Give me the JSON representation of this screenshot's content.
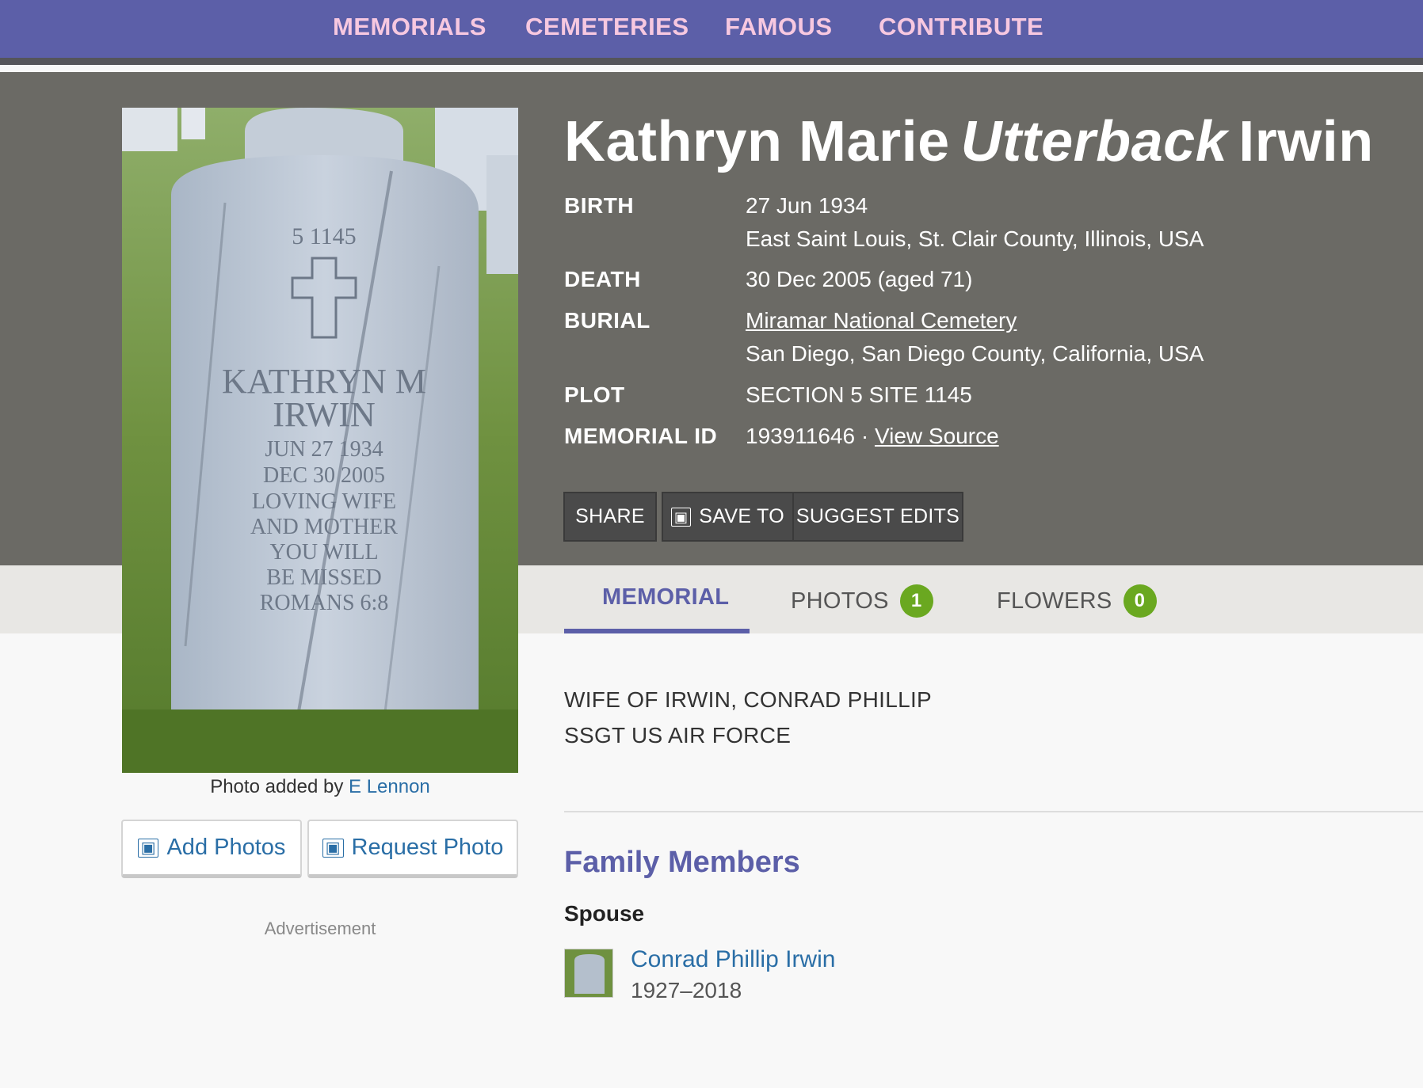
{
  "nav": {
    "items": [
      "MEMORIALS",
      "CEMETERIES",
      "FAMOUS",
      "CONTRIBUTE"
    ]
  },
  "memorial": {
    "first_names": "Kathryn Marie",
    "maiden_name": "Utterback",
    "last_name": "Irwin",
    "facts": {
      "birth_label": "BIRTH",
      "birth_date": "27 Jun 1934",
      "birth_place": "East Saint Louis, St. Clair County, Illinois, USA",
      "death_label": "DEATH",
      "death_date": "30 Dec 2005 (aged 71)",
      "burial_label": "BURIAL",
      "burial_cemetery": "Miramar National Cemetery",
      "burial_place": "San Diego, San Diego County, California, USA",
      "plot_label": "PLOT",
      "plot_value": "SECTION 5 SITE 1145",
      "id_label": "MEMORIAL ID",
      "id_value": "193911646",
      "id_sep": "·",
      "view_source": "View Source"
    }
  },
  "actions": {
    "share": "SHARE",
    "save_to": "SAVE TO",
    "suggest_edits": "SUGGEST EDITS",
    "save_icon": "bookmark-icon"
  },
  "photo": {
    "credit_prefix": "Photo added by",
    "credit_author": "E Lennon",
    "add_photos": "Add Photos",
    "request_photo": "Request Photo",
    "add_icon": "camera-icon",
    "request_icon": "photo-request-icon"
  },
  "headstone": {
    "number": "5   1145",
    "lines": [
      "KATHRYN M",
      "IRWIN",
      "JUN 27 1934",
      "DEC 30 2005",
      "LOVING WIFE",
      "AND MOTHER",
      "YOU WILL",
      "BE MISSED",
      "ROMANS 6:8"
    ]
  },
  "tabs": {
    "memorial": "MEMORIAL",
    "photos": "PHOTOS",
    "photos_count": "1",
    "flowers": "FLOWERS",
    "flowers_count": "0"
  },
  "bio": {
    "line1": "WIFE OF IRWIN, CONRAD PHILLIP",
    "line2": "SSGT US AIR FORCE"
  },
  "family": {
    "title": "Family Members",
    "spouse_label": "Spouse",
    "spouse_name": "Conrad Phillip Irwin",
    "spouse_dates": "1927–2018"
  },
  "advertisement": "Advertisement",
  "colors": {
    "nav_bg": "#5c5fa8",
    "nav_text": "#f7c8e0",
    "hero_bg": "#6b6a65",
    "link": "#2a6ea6",
    "badge": "#6aa820"
  }
}
